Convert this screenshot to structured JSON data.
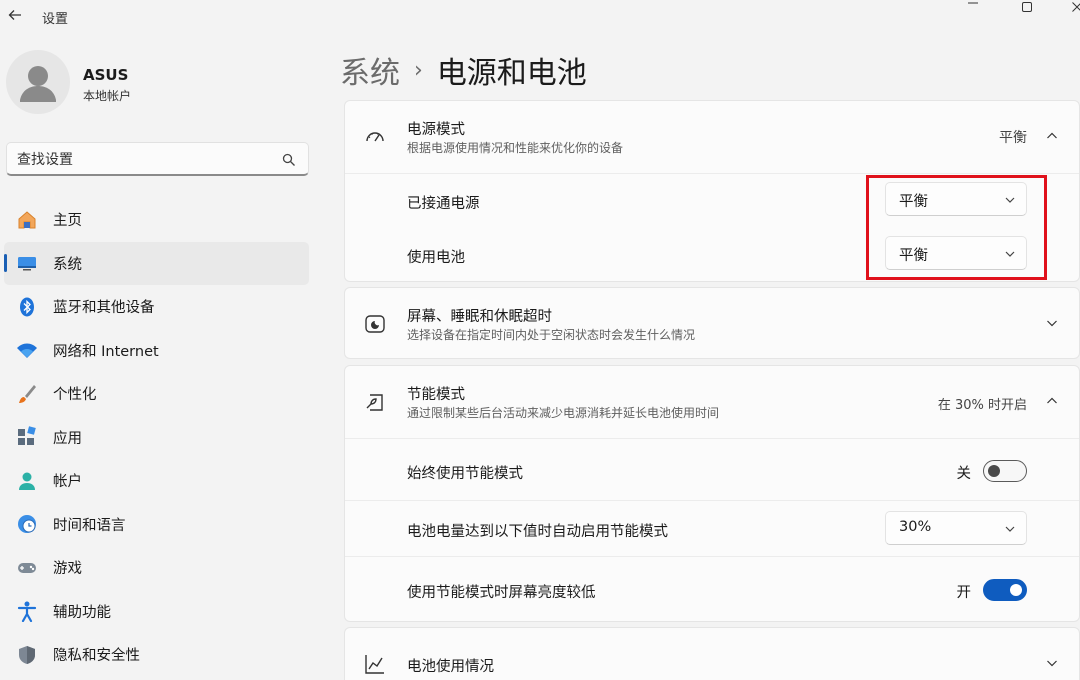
{
  "window": {
    "title": "设置",
    "icons": {
      "back": "back-arrow-icon",
      "minimize": "minimize-icon",
      "maximize": "maximize-icon",
      "close": "close-icon"
    }
  },
  "profile": {
    "name": "ASUS",
    "account_type": "本地帐户",
    "icon": "user-avatar-icon"
  },
  "search": {
    "value": "查找设置",
    "icon": "search-icon"
  },
  "sidebar": {
    "items": [
      {
        "label": "主页",
        "icon": "home-icon",
        "active": false
      },
      {
        "label": "系统",
        "icon": "system-display-icon",
        "active": true
      },
      {
        "label": "蓝牙和其他设备",
        "icon": "bluetooth-icon",
        "active": false
      },
      {
        "label": "网络和 Internet",
        "icon": "wifi-icon",
        "active": false
      },
      {
        "label": "个性化",
        "icon": "brush-icon",
        "active": false
      },
      {
        "label": "应用",
        "icon": "apps-icon",
        "active": false
      },
      {
        "label": "帐户",
        "icon": "person-icon",
        "active": false
      },
      {
        "label": "时间和语言",
        "icon": "globe-clock-icon",
        "active": false
      },
      {
        "label": "游戏",
        "icon": "gamepad-icon",
        "active": false
      },
      {
        "label": "辅助功能",
        "icon": "accessibility-icon",
        "active": false
      },
      {
        "label": "隐私和安全性",
        "icon": "shield-icon",
        "active": false
      }
    ]
  },
  "breadcrumb": {
    "parent": "系统",
    "separator": "›",
    "current": "电源和电池"
  },
  "power_mode": {
    "title": "电源模式",
    "description": "根据电源使用情况和性能来优化你的设备",
    "value": "平衡",
    "icon": "power-mode-gauge-icon",
    "expanded": true,
    "plugged_in": {
      "label": "已接通电源",
      "value": "平衡"
    },
    "on_battery": {
      "label": "使用电池",
      "value": "平衡"
    },
    "highlight_color": "#e0111b"
  },
  "screen_sleep": {
    "title": "屏幕、睡眠和休眠超时",
    "description": "选择设备在指定时间内处于空闲状态时会发生什么情况",
    "icon": "screen-sleep-icon",
    "expanded": false
  },
  "battery_saver": {
    "title": "节能模式",
    "description": "通过限制某些后台活动来减少电源消耗并延长电池使用时间",
    "value": "在 30% 时开启",
    "icon": "battery-saver-icon",
    "expanded": true,
    "always_on": {
      "label": "始终使用节能模式",
      "state_label": "关",
      "on": false
    },
    "auto_threshold": {
      "label": "电池电量达到以下值时自动启用节能模式",
      "value": "30%"
    },
    "lower_brightness": {
      "label": "使用节能模式时屏幕亮度较低",
      "state_label": "开",
      "on": true
    }
  },
  "battery_usage": {
    "title": "电池使用情况",
    "icon": "usage-chart-icon",
    "expanded": false
  },
  "colors": {
    "accent": "#0f5cbf",
    "background": "#f3f3f3",
    "card": "#fbfbfb"
  }
}
